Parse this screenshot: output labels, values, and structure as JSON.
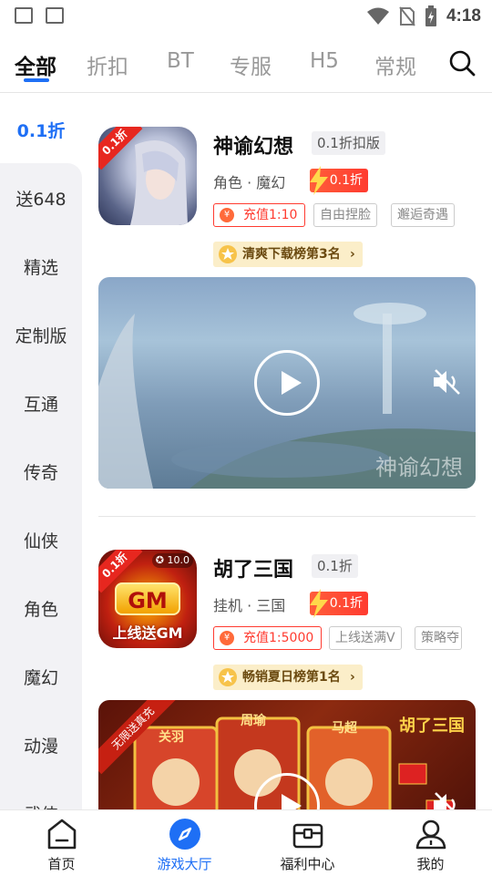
{
  "status_bar": {
    "time": "4:18"
  },
  "top_tabs": [
    "全部",
    "折扣",
    "BT",
    "专服",
    "H5",
    "常规"
  ],
  "sidebar": [
    "0.1折",
    "送648",
    "精选",
    "定制版",
    "互通",
    "传奇",
    "仙侠",
    "角色",
    "魔幻",
    "动漫",
    "武侠"
  ],
  "games": [
    {
      "title": "神谕幻想",
      "version": "0.1折扣版",
      "category": "角色 · 魔幻",
      "discount": "0.1折",
      "recharge": "充值1:10",
      "tags": [
        "自由捏脸",
        "邂逅奇遇"
      ],
      "rank": "清爽下载榜第3名",
      "icon_badge": "0.1折",
      "video_watermark": "神谕幻想"
    },
    {
      "title": "胡了三国",
      "version": "0.1折",
      "category": "挂机 · 三国",
      "discount": "0.1折",
      "recharge": "充值1:5000",
      "tags": [
        "上线送满V",
        "策略夺"
      ],
      "rank": "畅销夏日榜第1名",
      "icon_badge": "0.1折",
      "icon_score": "10.0",
      "icon_gm": "GM",
      "icon_caption": "上线送GM",
      "video_ribbon": "无限送真充",
      "video_heroes": [
        "关羽",
        "周瑜",
        "马超"
      ],
      "video_logo": "胡了三国"
    }
  ],
  "bottom_nav": [
    "首页",
    "游戏大厅",
    "福利中心",
    "我的"
  ],
  "colors": {
    "accent": "#1e6ff5",
    "discount": "#ff3b30",
    "rank_bg": "#fbeec9"
  }
}
